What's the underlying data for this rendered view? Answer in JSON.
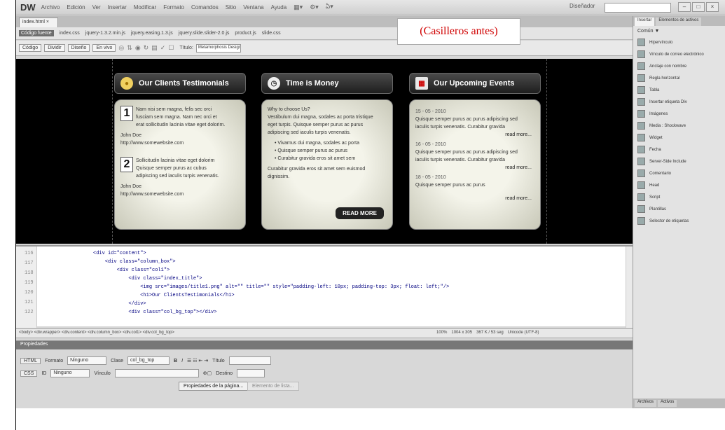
{
  "caption": "(Casilleros antes)",
  "app": {
    "logo": "DW",
    "menus": [
      "Archivo",
      "Edición",
      "Ver",
      "Insertar",
      "Modificar",
      "Formato",
      "Comandos",
      "Sitio",
      "Ventana",
      "Ayuda"
    ],
    "menu_icons": [
      "layout-icon",
      "view-icon",
      "extend-icon"
    ],
    "workspace": "Diseñador",
    "window_buttons": [
      "–",
      "□",
      "×"
    ]
  },
  "doc": {
    "tab": "index.html ×",
    "source_code_btn": "Código fuente",
    "related_files": [
      "index.css",
      "jquery-1.3.2.min.js",
      "jquery.easing.1.3.js",
      "jquery.slide.slider-2.0.js",
      "product.js",
      "slide.css"
    ],
    "toolbar": {
      "code_btn": "Código",
      "split_btn": "Dividir",
      "design_btn": "Diseño",
      "live_btn": "En vivo",
      "title_label": "Título:",
      "title_value": "Metamorphosis Design | Free Cs"
    }
  },
  "design": {
    "columns": [
      {
        "title": "Our Clients Testimonials",
        "icon": "speech-bubble-icon",
        "testimonials": [
          {
            "num": "1",
            "lines": [
              "Nam nisi sem magna, felis sec orci",
              "fusciam sem magna. Nam nec orci et",
              "erat sollicitudin lacinia vitae eget dolorim."
            ],
            "name": "John Doe",
            "link": "http://www.somewebsite.com"
          },
          {
            "num": "2",
            "lines": [
              "Sollicitudin lacinia vitae eget dolorim",
              "Quisque semper purus ac cubus",
              "adipiscing sed iaculis turpis venenatis."
            ],
            "name": "John Doe",
            "link": "http://www.somewebsite.com"
          }
        ]
      },
      {
        "title": "Time is Money",
        "icon": "clock-icon",
        "intro": [
          "Why to choose Us?",
          "Vestibulum dui magna, sodales ac porta tristique",
          "eget turpis. Quisque semper purus ac purus",
          "adipiscing sed iaculis turpis venenatis."
        ],
        "bullets": [
          "Vivamus dui magna, sodales ac porta",
          "Quisque semper purus ac purus",
          "Curabitur gravida eros sit amet sem"
        ],
        "outro": [
          "Curabitur gravida eros sit amet sem euismod",
          "dignissim."
        ],
        "button": "READ MORE"
      },
      {
        "title": "Our Upcoming Events",
        "icon": "calendar-icon",
        "events": [
          {
            "date": "15 - 05 - 2010",
            "lines": [
              "Quisque semper purus ac purus adipiscing sed",
              "iaculis turpis venenatis. Curabitur gravida"
            ],
            "more": "read more..."
          },
          {
            "date": "16 - 05 - 2010",
            "lines": [
              "Quisque semper purus ac purus adipiscing sed",
              "iaculis turpis venenatis. Curabitur gravida"
            ],
            "more": "read more..."
          },
          {
            "date": "18 - 05 - 2010",
            "lines": [
              "Quisque semper purus ac purus"
            ],
            "more": "read more..."
          }
        ]
      }
    ]
  },
  "code": {
    "line_numbers": [
      "116",
      "117",
      "118",
      "119",
      "120",
      "121",
      "122"
    ],
    "lines": [
      "<div id=\"content\">",
      "    <div class=\"column_box\">",
      "        <div class=\"col1\">",
      "            <div class=\"index_title\">",
      "                <img src=\"images/title1.png\" alt=\"\" title=\"\" style=\"padding-left: 10px; padding-top: 3px; float: left;\"/>",
      "                <h1>Our ClientsTestimonials</h1>",
      "            </div>",
      "            <div class=\"col_bg_top\"></div>"
    ]
  },
  "status": {
    "tag_path": "<body> <div.wrapper> <div.content> <div.column_box> <div.col1> <div.col_bg_top>",
    "zoom": "100%",
    "dimensions": "1004 x 305",
    "size_time": "367 K / 53 seg",
    "encoding": "Unicode (UTF-8)"
  },
  "props": {
    "title": "Propiedades",
    "html_btn": "HTML",
    "css_btn": "CSS",
    "format_label": "Formato",
    "format_value": "Ninguno",
    "class_label": "Clase",
    "class_value": "col_bg_top",
    "bold": "B",
    "italic": "I",
    "link_label": "Vínculo",
    "id_label": "ID",
    "id_value": "Ninguno",
    "title_label": "Título",
    "target_label": "Destino",
    "page_props_btn": "Propiedades de la página...",
    "list_item_btn": "Elemento de lista..."
  },
  "right_panel": {
    "tabs": [
      "Insertar",
      "Elementos de activos"
    ],
    "category": "Común ▼",
    "items": [
      "Hipervínculo",
      "Vínculo de correo electrónico",
      "Anclaje con nombre",
      "Regla horizontal",
      "Tabla",
      "Insertar etiqueta Div",
      "Imágenes",
      "Media : Shockwave",
      "Widget",
      "Fecha",
      "Server-Side Include",
      "Comentario",
      "Head",
      "Script",
      "Plantillas",
      "Selector de etiquetas"
    ],
    "bottom_tabs": [
      "Archivos",
      "Activos"
    ]
  }
}
